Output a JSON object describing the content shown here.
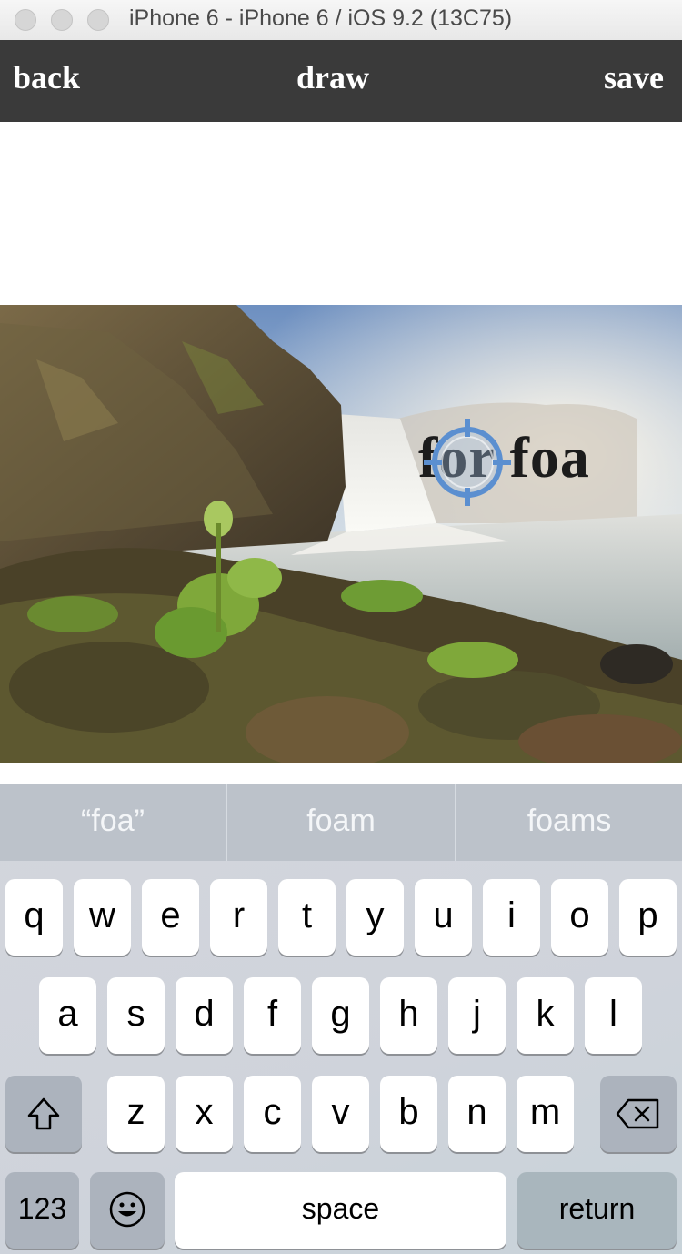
{
  "simulator": {
    "title": "iPhone 6 - iPhone 6 / iOS 9.2 (13C75)"
  },
  "navbar": {
    "back_label": "back",
    "title": "draw",
    "save_label": "save"
  },
  "canvas": {
    "overlay_text": "for foa",
    "photo_icon": "waterfall-landscape-photo",
    "cursor_icon": "crosshair-icon"
  },
  "keyboard": {
    "suggestions": [
      "“foa”",
      "foam",
      "foams"
    ],
    "row1": [
      "q",
      "w",
      "e",
      "r",
      "t",
      "y",
      "u",
      "i",
      "o",
      "p"
    ],
    "row2": [
      "a",
      "s",
      "d",
      "f",
      "g",
      "h",
      "j",
      "k",
      "l"
    ],
    "row3": [
      "z",
      "x",
      "c",
      "v",
      "b",
      "n",
      "m"
    ],
    "numbers_label": "123",
    "space_label": "space",
    "return_label": "return",
    "shift_icon": "shift-icon",
    "delete_icon": "delete-icon",
    "emoji_icon": "emoji-icon"
  },
  "colors": {
    "navbar_bg": "#3a3a3a",
    "crosshair": "#5b8fd0"
  }
}
